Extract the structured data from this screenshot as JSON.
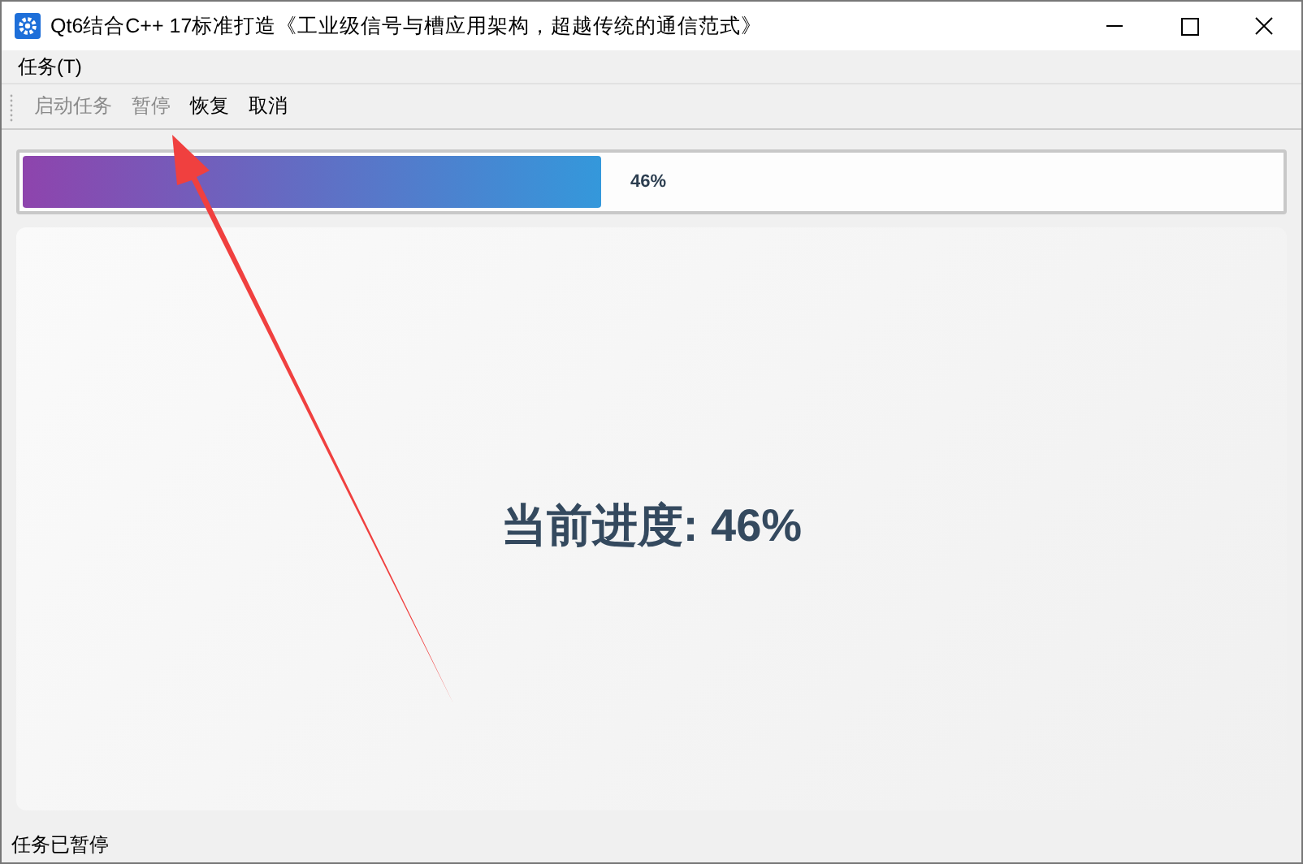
{
  "window": {
    "title": "Qt6结合C++ 17标准打造《工业级信号与槽应用架构，超越传统的通信范式》"
  },
  "menu": [
    {
      "label": "任务(T)"
    }
  ],
  "toolbar": [
    {
      "label": "启动任务",
      "disabled": true
    },
    {
      "label": "暂停",
      "disabled": true
    },
    {
      "label": "恢复",
      "disabled": false
    },
    {
      "label": "取消",
      "disabled": false
    }
  ],
  "progress": {
    "level": 0.46,
    "text": "46%"
  },
  "progress_label": "当前进度: 46%",
  "status_bar": "任务已暂停"
}
